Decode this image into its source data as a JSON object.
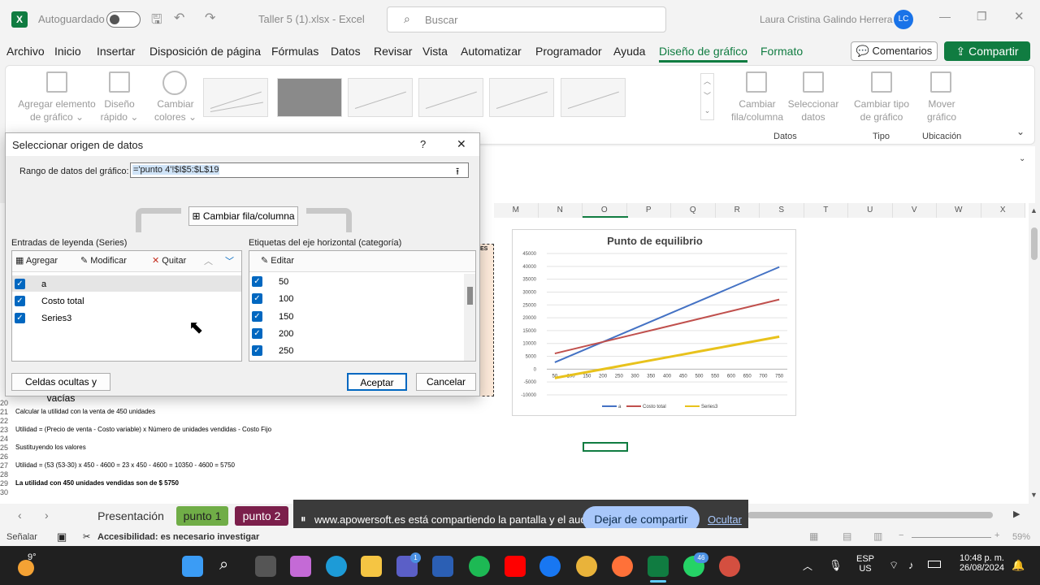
{
  "titlebar": {
    "autosave": "Autoguardado",
    "filename": "Taller 5 (1).xlsx",
    "app": "Excel",
    "search_placeholder": "Buscar",
    "user": "Laura Cristina Galindo Herrera",
    "initials": "LC"
  },
  "menu": [
    "Archivo",
    "Inicio",
    "Insertar",
    "Disposición de página",
    "Fórmulas",
    "Datos",
    "Revisar",
    "Vista",
    "Automatizar",
    "Programador",
    "Ayuda",
    "Diseño de gráfico",
    "Formato"
  ],
  "comments_label": "Comentarios",
  "share_label": "Compartir",
  "ribbon": {
    "add_element": "Agregar elemento",
    "add_element2": "de gráfico",
    "quick_layout": "Diseño",
    "quick_layout2": "rápido",
    "change_colors": "Cambiar",
    "change_colors2": "colores",
    "switch_row_col": "Cambiar",
    "switch_row_col2": "fila/columna",
    "select_data": "Seleccionar",
    "select_data2": "datos",
    "change_type": "Cambiar tipo",
    "change_type2": "de gráfico",
    "move_chart": "Mover",
    "move_chart2": "gráfico",
    "group_data": "Datos",
    "group_type": "Tipo",
    "group_location": "Ubicación"
  },
  "columns": [
    "M",
    "N",
    "O",
    "P",
    "Q",
    "R",
    "S",
    "T",
    "U",
    "V",
    "W",
    "X"
  ],
  "rows": [
    {
      "n": "20",
      "t": ""
    },
    {
      "n": "21",
      "t": "Calcular la utilidad con la venta de 450 unidades"
    },
    {
      "n": "22",
      "t": ""
    },
    {
      "n": "23",
      "t": "Utilidad = (Precio de venta - Costo variable) x Número de unidades vendidas - Costo Fijo"
    },
    {
      "n": "24",
      "t": ""
    },
    {
      "n": "25",
      "t": "Sustituyendo los valores"
    },
    {
      "n": "26",
      "t": ""
    },
    {
      "n": "27",
      "t": "Utilidad = (53   (53-30) x 450 - 4600 = 23 x 450 - 4600 = 10350 - 4600 = 5750"
    },
    {
      "n": "28",
      "t": ""
    },
    {
      "n": "29",
      "t": "La utilidad con 450 unidades vendidas son de $ 5750"
    },
    {
      "n": "30",
      "t": ""
    }
  ],
  "chart_data": {
    "type": "line",
    "title": "Punto de equilibrio",
    "x": [
      50,
      100,
      150,
      200,
      250,
      300,
      350,
      400,
      450,
      500,
      550,
      600,
      650,
      700,
      750
    ],
    "ylim": [
      -10000,
      45000
    ],
    "yticks": [
      -10000,
      -5000,
      0,
      5000,
      10000,
      15000,
      20000,
      25000,
      30000,
      35000,
      40000,
      45000
    ],
    "series": [
      {
        "name": "a",
        "color": "#4472c4",
        "values": [
          2650,
          5300,
          7950,
          10600,
          13250,
          15900,
          18550,
          21200,
          23850,
          26500,
          29150,
          31800,
          34450,
          37100,
          39750
        ]
      },
      {
        "name": "Costo total",
        "color": "#c0504d",
        "values": [
          6100,
          7600,
          9100,
          10600,
          12100,
          13600,
          15100,
          16600,
          18100,
          19600,
          21100,
          22600,
          24100,
          25600,
          27100
        ]
      },
      {
        "name": "Series3",
        "color": "#e8c21c",
        "values": [
          -3450,
          -2300,
          -1150,
          0,
          1150,
          2300,
          3450,
          4600,
          5750,
          6900,
          8050,
          9200,
          10350,
          11500,
          12650
        ]
      }
    ],
    "legend": "bottom"
  },
  "dialog": {
    "title": "Seleccionar origen de datos",
    "help": "?",
    "close": "✕",
    "range_label": "Rango de datos del gráfico:",
    "range_value": "='punto 4'!$I$5:$L$19",
    "switch_btn": "Cambiar fila/columna",
    "legend_label": "Entradas de leyenda (Series)",
    "add": "Agregar",
    "edit": "Modificar",
    "remove": "Quitar",
    "series": [
      "a",
      "Costo total",
      "Series3"
    ],
    "axis_label": "Etiquetas del eje horizontal (categoría)",
    "axis_edit": "Editar",
    "categories": [
      "50",
      "100",
      "150",
      "200",
      "250"
    ],
    "hidden_btn": "Celdas ocultas y vacías",
    "ok": "Aceptar",
    "cancel": "Cancelar"
  },
  "sheet_tabs": [
    "Presentación",
    "punto 1",
    "punto 2"
  ],
  "share_notice": {
    "text": "www.apowersoft.es está compartiendo la pantalla y el audio.",
    "stop": "Dejar de compartir",
    "hide": "Ocultar"
  },
  "status": {
    "mode": "Señalar",
    "accessibility": "Accesibilidad: es necesario investigar",
    "zoom": "59%"
  },
  "taskbar": {
    "temp": "9°",
    "lang1": "ESP",
    "lang2": "US",
    "time": "10:48 p. m.",
    "date": "26/08/2024",
    "badge_teams": "1",
    "badge_whatsapp": "46"
  }
}
